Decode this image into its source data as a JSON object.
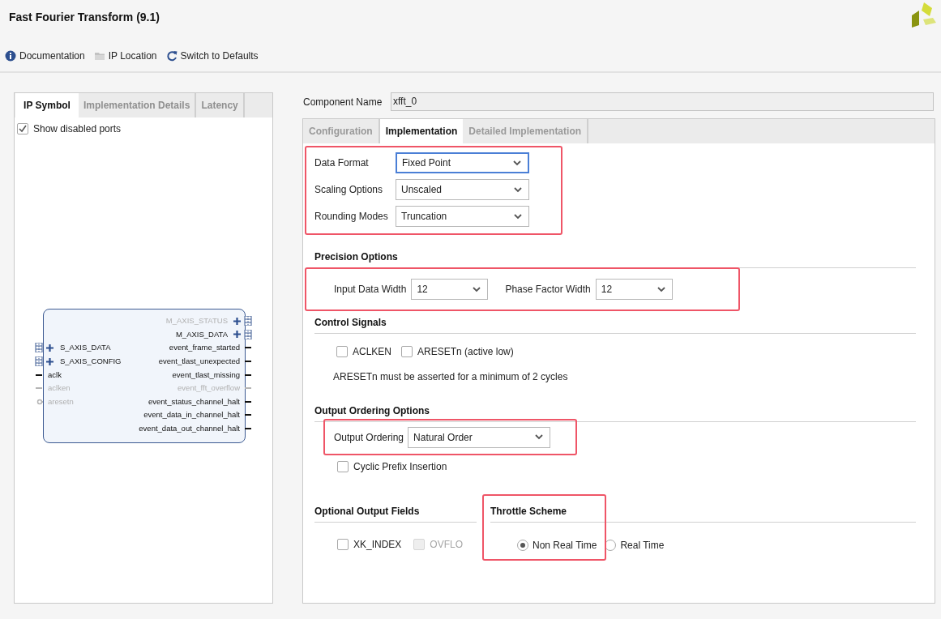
{
  "window": {
    "title": "Fast Fourier Transform (9.1)"
  },
  "toolbar": [
    {
      "label": "Documentation",
      "kind": "info"
    },
    {
      "label": "IP Location",
      "kind": "folder"
    },
    {
      "label": "Switch to Defaults",
      "kind": "refresh"
    }
  ],
  "left_panel": {
    "tabs": [
      {
        "label": "IP Symbol",
        "selected": true
      },
      {
        "label": "Implementation Details",
        "selected": false
      },
      {
        "label": "Latency",
        "selected": false
      }
    ],
    "show_disabled_ports": {
      "label": "Show disabled ports",
      "checked": true
    },
    "symbol": {
      "left_ports": [
        {
          "label": "S_AXIS_DATA",
          "kind": "bus",
          "disabled": false
        },
        {
          "label": "S_AXIS_CONFIG",
          "kind": "bus",
          "disabled": false
        },
        {
          "label": "aclk",
          "kind": "wire",
          "disabled": false
        },
        {
          "label": "aclken",
          "kind": "wire",
          "disabled": true
        },
        {
          "label": "aresetn",
          "kind": "reset",
          "disabled": true
        }
      ],
      "right_ports": [
        {
          "label": "M_AXIS_STATUS",
          "kind": "bus",
          "disabled": true
        },
        {
          "label": "M_AXIS_DATA",
          "kind": "bus",
          "disabled": false
        },
        {
          "label": "event_frame_started",
          "kind": "wire",
          "disabled": false
        },
        {
          "label": "event_tlast_unexpected",
          "kind": "wire",
          "disabled": false
        },
        {
          "label": "event_tlast_missing",
          "kind": "wire",
          "disabled": false
        },
        {
          "label": "event_fft_overflow",
          "kind": "wire",
          "disabled": true
        },
        {
          "label": "event_status_channel_halt",
          "kind": "wire",
          "disabled": false
        },
        {
          "label": "event_data_in_channel_halt",
          "kind": "wire",
          "disabled": false
        },
        {
          "label": "event_data_out_channel_halt",
          "kind": "wire",
          "disabled": false
        }
      ]
    }
  },
  "component_name": {
    "label": "Component Name",
    "value": "xfft_0"
  },
  "config_tabs": [
    {
      "label": "Configuration",
      "selected": false
    },
    {
      "label": "Implementation",
      "selected": true
    },
    {
      "label": "Detailed Implementation",
      "selected": false
    }
  ],
  "format_group": {
    "highlighted": true,
    "fields": [
      {
        "label": "Data Format",
        "value": "Fixed Point",
        "focused": true
      },
      {
        "label": "Scaling Options",
        "value": "Unscaled",
        "focused": false
      },
      {
        "label": "Rounding Modes",
        "value": "Truncation",
        "focused": false
      }
    ]
  },
  "precision_options": {
    "heading": "Precision Options",
    "highlighted": true,
    "fields": [
      {
        "label": "Input Data Width",
        "value": "12"
      },
      {
        "label": "Phase Factor Width",
        "value": "12"
      }
    ]
  },
  "control_signals": {
    "heading": "Control Signals",
    "checkboxes": [
      {
        "label": "ACLKEN",
        "checked": false,
        "disabled": false
      },
      {
        "label": "ARESETn (active low)",
        "checked": false,
        "disabled": false
      }
    ],
    "note": "ARESETn must be asserted for a minimum of 2 cycles"
  },
  "output_ordering_options": {
    "heading": "Output Ordering Options",
    "highlighted": true,
    "field": {
      "label": "Output Ordering",
      "value": "Natural Order"
    },
    "checkboxes": [
      {
        "label": "Cyclic Prefix Insertion",
        "checked": false,
        "disabled": false
      }
    ]
  },
  "optional_output_fields": {
    "heading": "Optional Output Fields",
    "checkboxes": [
      {
        "label": "XK_INDEX",
        "checked": false,
        "disabled": false
      },
      {
        "label": "OVFLO",
        "checked": false,
        "disabled": true
      }
    ]
  },
  "throttle_scheme": {
    "heading": "Throttle Scheme",
    "highlighted": true,
    "options": [
      {
        "label": "Non Real Time",
        "selected": true
      },
      {
        "label": "Real Time",
        "selected": false
      }
    ]
  }
}
